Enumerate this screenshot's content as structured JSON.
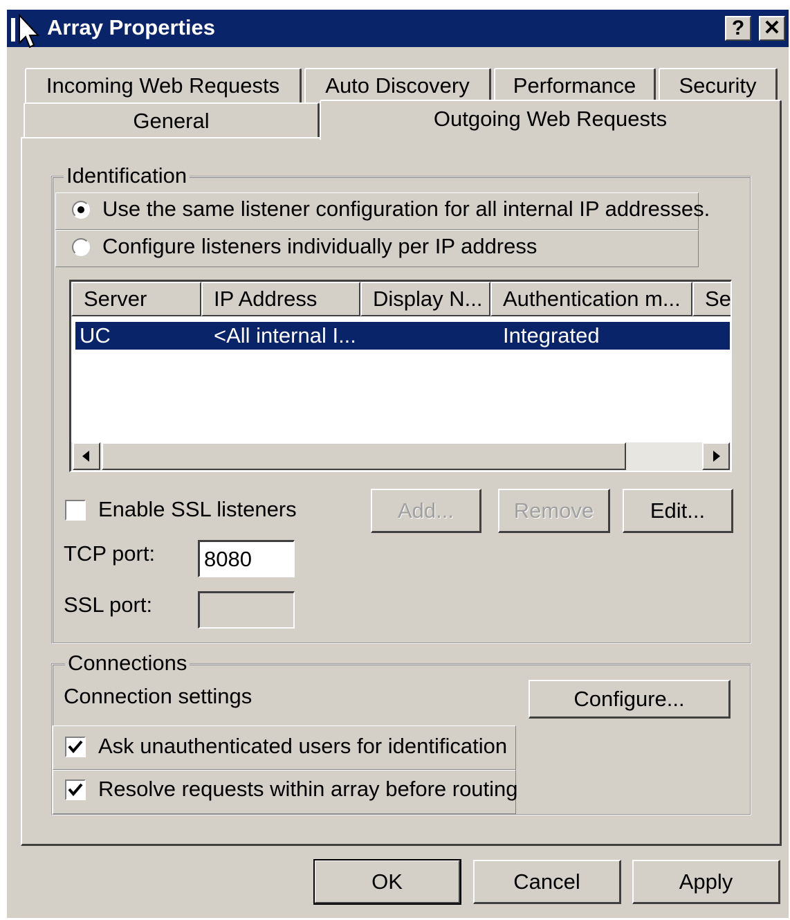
{
  "window": {
    "title": "Array Properties",
    "help_label": "?",
    "close_label": "✕"
  },
  "tabs": {
    "row1": [
      "Incoming Web Requests",
      "Auto Discovery",
      "Performance",
      "Security"
    ],
    "row2": [
      "General",
      "Outgoing Web Requests"
    ],
    "active": "Outgoing Web Requests"
  },
  "identification": {
    "title": "Identification",
    "option_same": "Use the same listener configuration for all internal IP addresses.",
    "option_individual": "Configure listeners individually per IP address",
    "selected": "option_same"
  },
  "listeners": {
    "columns": [
      "Server",
      "IP Address",
      "Display N...",
      "Authentication m...",
      "Se"
    ],
    "rows": [
      {
        "server": "UC",
        "ip": "<All internal I...",
        "display": "",
        "auth": "Integrated"
      }
    ]
  },
  "ssl": {
    "enable_label": "Enable SSL listeners",
    "enabled": false,
    "tcp_label": "TCP port:",
    "tcp_value": "8080",
    "ssl_label": "SSL port:",
    "ssl_value": ""
  },
  "list_buttons": {
    "add": "Add...",
    "remove": "Remove",
    "edit": "Edit..."
  },
  "connections": {
    "title": "Connections",
    "settings_label": "Connection settings",
    "configure": "Configure...",
    "ask_label": "Ask unauthenticated users for identification",
    "ask_checked": true,
    "resolve_label": "Resolve requests within array before routing",
    "resolve_checked": true
  },
  "footer": {
    "ok": "OK",
    "cancel": "Cancel",
    "apply": "Apply"
  },
  "colors": {
    "titlebar": "#0a246a",
    "face": "#d4d0c8",
    "selection": "#0a246a"
  }
}
